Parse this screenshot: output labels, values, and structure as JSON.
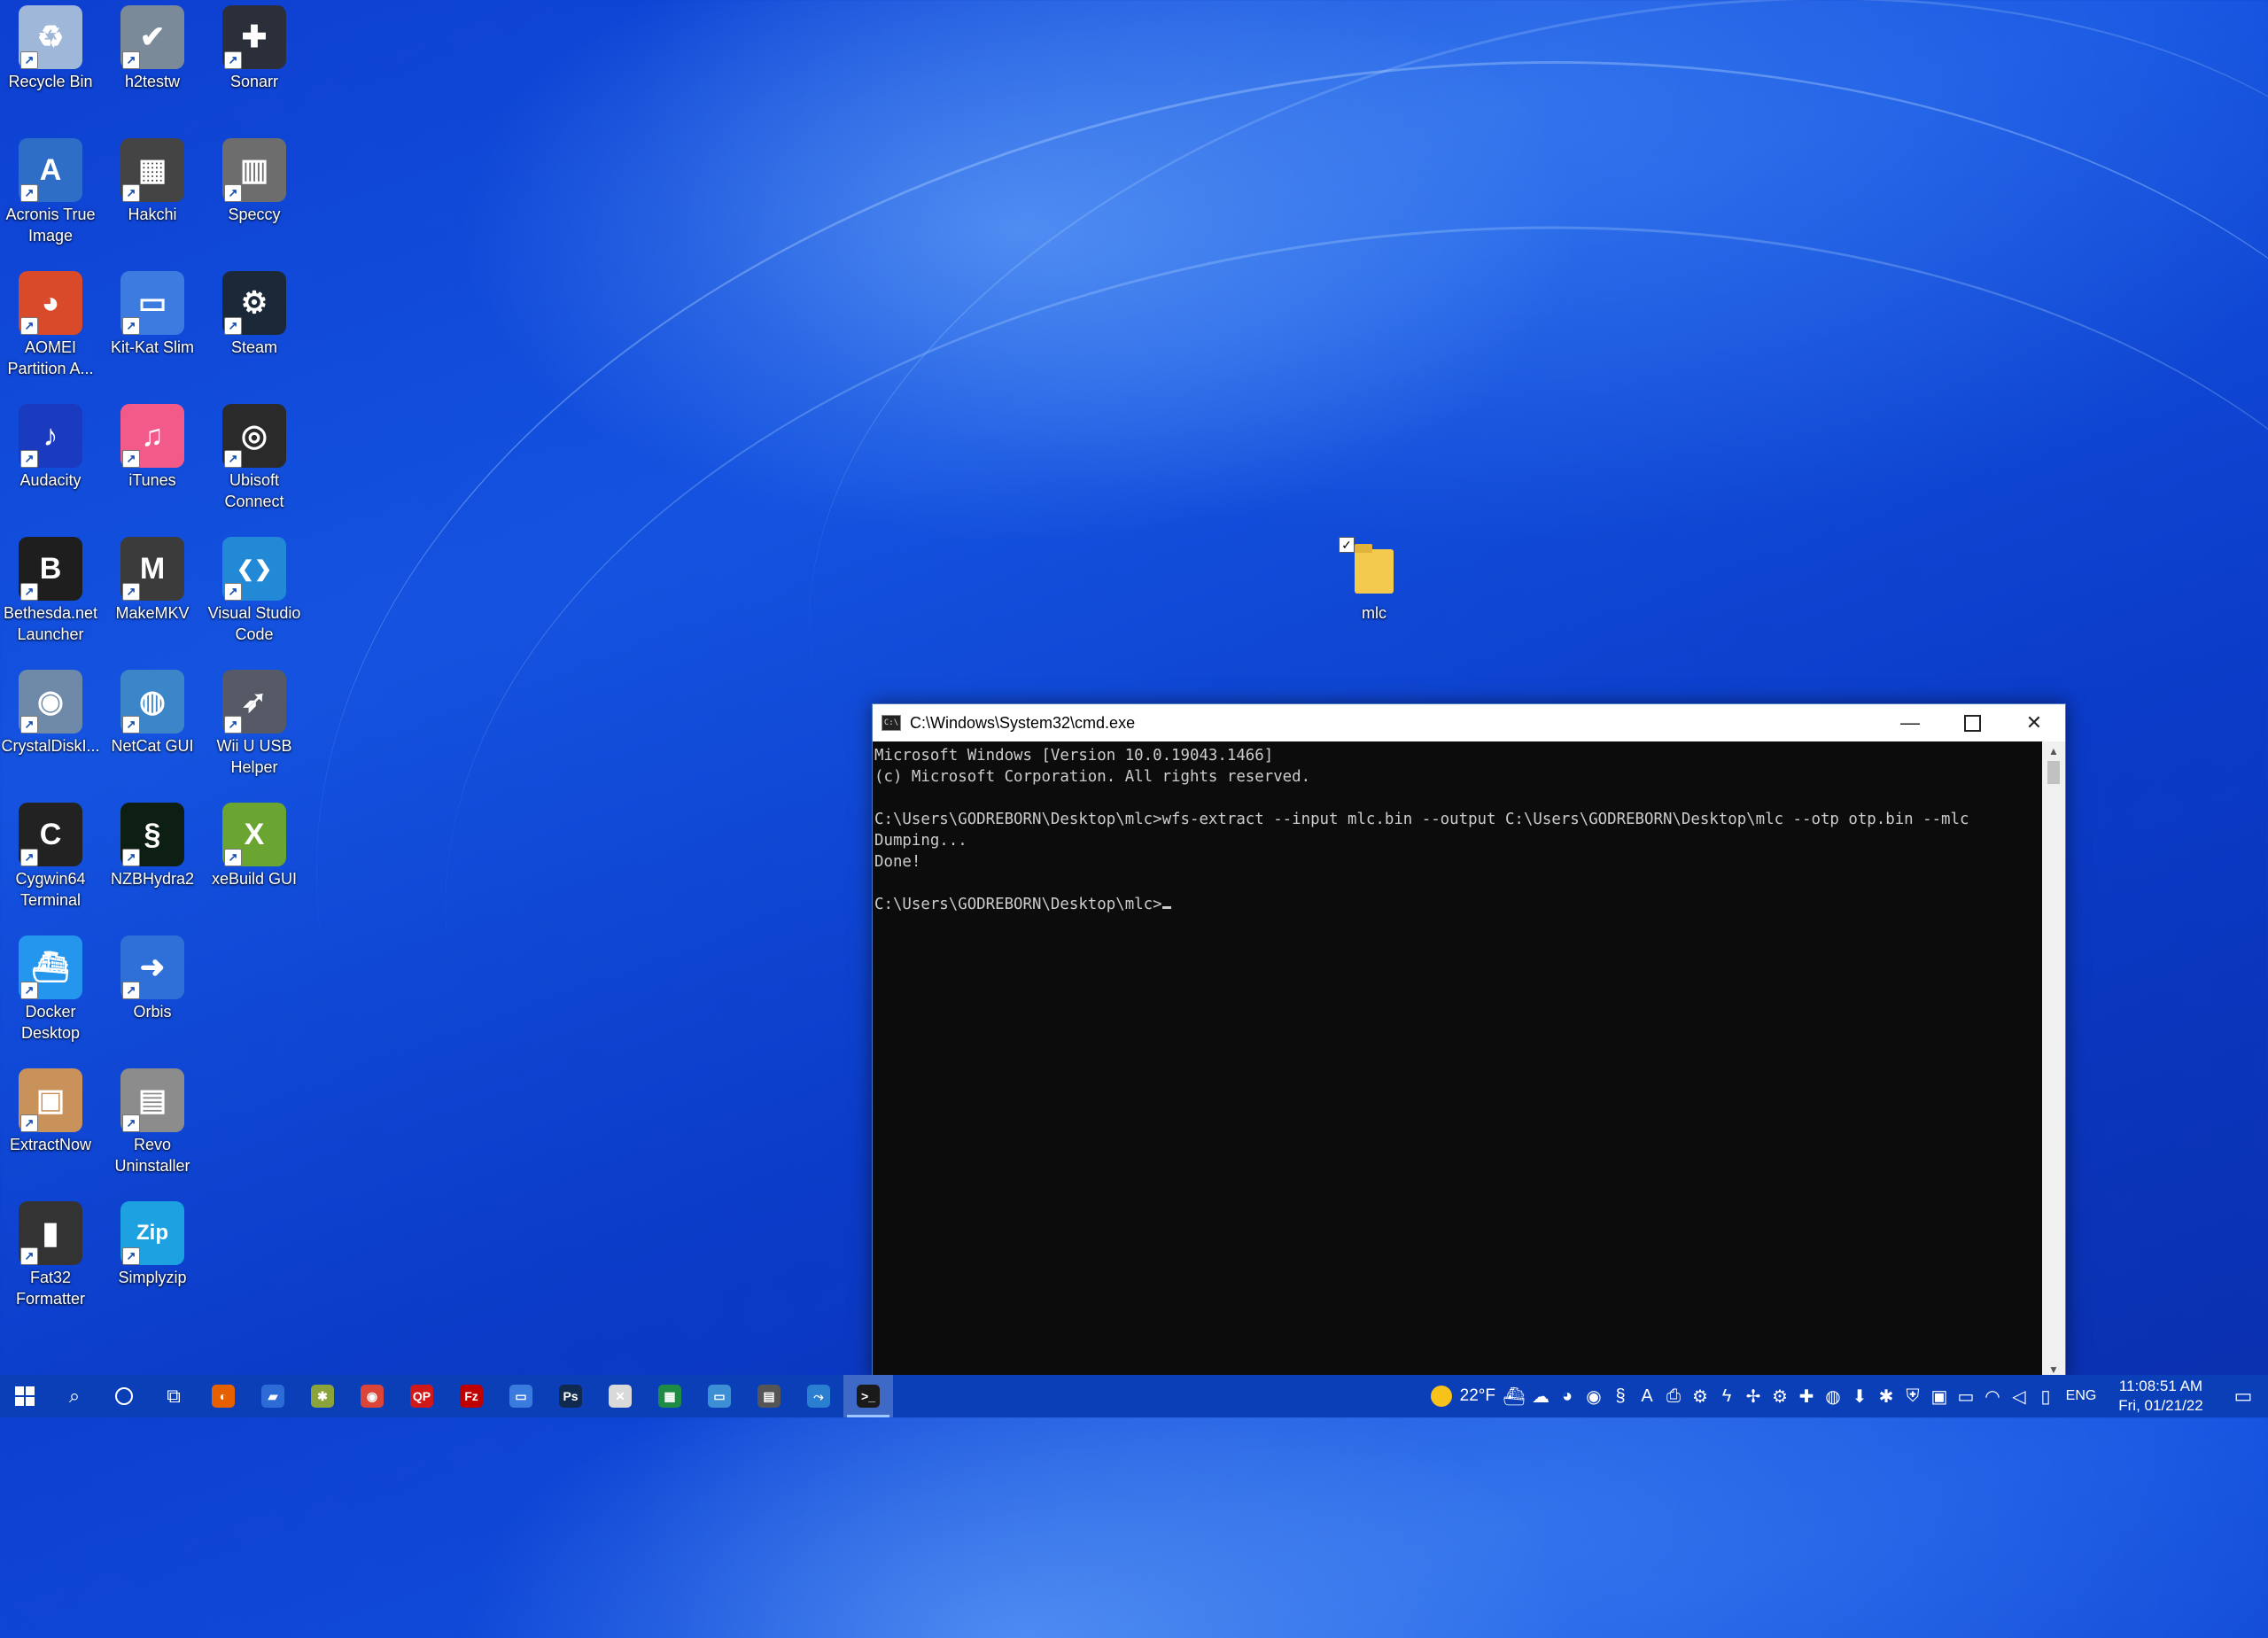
{
  "desktop": {
    "icons": [
      {
        "label": "Recycle Bin",
        "icon": "recycle-bin-icon",
        "color": "#9fb7d8",
        "glyph": "♻"
      },
      {
        "label": "h2testw",
        "icon": "h2testw-icon",
        "color": "#7a8a99",
        "glyph": "✔"
      },
      {
        "label": "Sonarr",
        "icon": "sonarr-icon",
        "color": "#2a2f3a",
        "glyph": "✚"
      },
      {
        "label": "Acronis True Image",
        "icon": "acronis-icon",
        "color": "#2f6ec7",
        "glyph": "A"
      },
      {
        "label": "Hakchi",
        "icon": "hakchi-icon",
        "color": "#444444",
        "glyph": "▦"
      },
      {
        "label": "Speccy",
        "icon": "speccy-icon",
        "color": "#6d6d6d",
        "glyph": "▥"
      },
      {
        "label": "AOMEI Partition A...",
        "icon": "aomei-icon",
        "color": "#d94a2b",
        "glyph": "◕"
      },
      {
        "label": "Kit-Kat Slim",
        "icon": "kitkat-slim-icon",
        "color": "#3d7be0",
        "glyph": "▭"
      },
      {
        "label": "Steam",
        "icon": "steam-icon",
        "color": "#1b2838",
        "glyph": "⚙"
      },
      {
        "label": "Audacity",
        "icon": "audacity-icon",
        "color": "#1a3bbf",
        "glyph": "♪"
      },
      {
        "label": "iTunes",
        "icon": "itunes-icon",
        "color": "#f25a8a",
        "glyph": "♫"
      },
      {
        "label": "Ubisoft Connect",
        "icon": "ubisoft-icon",
        "color": "#2a2a2a",
        "glyph": "◎"
      },
      {
        "label": "Bethesda.net Launcher",
        "icon": "bethesda-icon",
        "color": "#1e1e1e",
        "glyph": "B"
      },
      {
        "label": "MakeMKV",
        "icon": "makemkv-icon",
        "color": "#3b3b3b",
        "glyph": "M"
      },
      {
        "label": "Visual Studio Code",
        "icon": "vscode-icon",
        "color": "#2189d6",
        "glyph": "❮❯"
      },
      {
        "label": "CrystalDiskI...",
        "icon": "crystaldisk-icon",
        "color": "#6f8aa8",
        "glyph": "◉"
      },
      {
        "label": "NetCat GUI",
        "icon": "netcat-icon",
        "color": "#3a86c8",
        "glyph": "◍"
      },
      {
        "label": "Wii U USB Helper",
        "icon": "wiiu-usb-helper-icon",
        "color": "#555a66",
        "glyph": "➶"
      },
      {
        "label": "Cygwin64 Terminal",
        "icon": "cygwin-icon",
        "color": "#222222",
        "glyph": "C"
      },
      {
        "label": "NZBHydra2",
        "icon": "nzbhydra-icon",
        "color": "#0d1f12",
        "glyph": "§"
      },
      {
        "label": "xeBuild GUI",
        "icon": "xebuild-icon",
        "color": "#6aa532",
        "glyph": "X"
      },
      {
        "label": "Docker Desktop",
        "icon": "docker-icon",
        "color": "#2496ed",
        "glyph": "⛴"
      },
      {
        "label": "Orbis",
        "icon": "orbis-icon",
        "color": "#2f6fd8",
        "glyph": "➜"
      },
      {
        "label": "",
        "icon": "empty-slot",
        "color": "",
        "glyph": ""
      },
      {
        "label": "ExtractNow",
        "icon": "extractnow-icon",
        "color": "#c9925a",
        "glyph": "▣"
      },
      {
        "label": "Revo Uninstaller",
        "icon": "revo-uninstaller-icon",
        "color": "#8c8c8c",
        "glyph": "▤"
      },
      {
        "label": "",
        "icon": "empty-slot",
        "color": "",
        "glyph": ""
      },
      {
        "label": "Fat32 Formatter",
        "icon": "fat32-formatter-icon",
        "color": "#333333",
        "glyph": "▮"
      },
      {
        "label": "Simplyzip",
        "icon": "simplyzip-icon",
        "color": "#1da1e0",
        "glyph": "Zip"
      }
    ],
    "folder": {
      "label": "mlc",
      "icon": "folder-icon"
    }
  },
  "cmd": {
    "title": "C:\\Windows\\System32\\cmd.exe",
    "lines": [
      "Microsoft Windows [Version 10.0.19043.1466]",
      "(c) Microsoft Corporation. All rights reserved.",
      "",
      "C:\\Users\\GODREBORN\\Desktop\\mlc>wfs-extract --input mlc.bin --output C:\\Users\\GODREBORN\\Desktop\\mlc --otp otp.bin --mlc",
      "Dumping...",
      "Done!",
      "",
      "C:\\Users\\GODREBORN\\Desktop\\mlc>"
    ]
  },
  "taskbar": {
    "apps": [
      {
        "name": "firefox-icon",
        "color": "#e66000",
        "glyph": "◐"
      },
      {
        "name": "file-explorer-icon",
        "color": "#2d6bd6",
        "glyph": "▰"
      },
      {
        "name": "pinned-app-icon",
        "color": "#8aa33a",
        "glyph": "✱"
      },
      {
        "name": "chrome-icon",
        "color": "#db4437",
        "glyph": "◉"
      },
      {
        "name": "qbittorrent-red-icon",
        "color": "#d01818",
        "glyph": "QP"
      },
      {
        "name": "filezilla-icon",
        "color": "#bf0000",
        "glyph": "Fz"
      },
      {
        "name": "window-app-icon",
        "color": "#3a7be0",
        "glyph": "▭"
      },
      {
        "name": "photoshop-icon",
        "color": "#0f2a4e",
        "glyph": "Ps"
      },
      {
        "name": "excel-like-icon",
        "color": "#d9d9d9",
        "glyph": "✕"
      },
      {
        "name": "spreadsheet-icon",
        "color": "#1e8c44",
        "glyph": "▦"
      },
      {
        "name": "monitor-app-icon",
        "color": "#3c8fd4",
        "glyph": "▭"
      },
      {
        "name": "calculator-icon",
        "color": "#555555",
        "glyph": "▤"
      },
      {
        "name": "network-app-icon",
        "color": "#2a7fd0",
        "glyph": "⤳"
      },
      {
        "name": "cmd-icon",
        "color": "#1a1a1a",
        "glyph": ">_"
      }
    ],
    "weather": {
      "temp": "22°F"
    },
    "tray_icons": [
      "docker-tray-icon",
      "onedrive-icon",
      "discord-icon",
      "obs-icon",
      "nzb-tray-icon",
      "font-tray-icon",
      "printer-icon",
      "system-icon",
      "flash-icon",
      "slack-icon",
      "steam-tray-icon",
      "sonarr-tray-icon",
      "qbittorrent-icon",
      "download-icon",
      "bluetooth-icon",
      "security-icon",
      "meet-icon",
      "battery-icon",
      "wifi-icon",
      "volume-icon",
      "usb-icon"
    ],
    "language": "ENG",
    "time": "11:08:51 AM",
    "date": "Fri, 01/21/22"
  }
}
